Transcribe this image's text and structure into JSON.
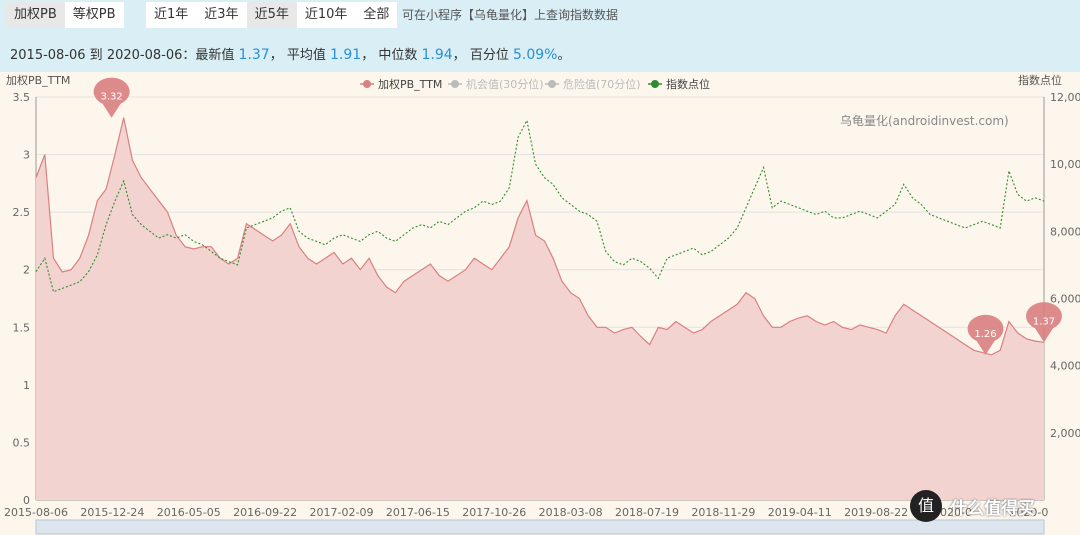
{
  "toolbar": {
    "pb_types": [
      "加权PB",
      "等权PB"
    ],
    "ranges": [
      "近1年",
      "近3年",
      "近5年",
      "近10年",
      "全部"
    ],
    "hint": "可在小程序【乌龟量化】上查询指数数据"
  },
  "stats": {
    "period": "2015-08-06 到 2020-08-06：",
    "latest_label": "最新值",
    "latest": "1.37",
    "sep1": "，",
    "avg_label": "平均值",
    "avg": "1.91",
    "sep2": "，",
    "median_label": "中位数",
    "median": "1.94",
    "sep3": "，",
    "pct_label": "百分位",
    "pct": "5.09%",
    "end": "。"
  },
  "watermark": "乌龟量化(androidinvest.com)",
  "logo": {
    "symbol": "值",
    "text": "什么值得买"
  },
  "colors": {
    "pb": "#d98080",
    "pb_fill": "#f2d3d0",
    "index": "#2e8b2e",
    "legend_dim": "#bbbbbb"
  },
  "chart_data": {
    "type": "line",
    "title": "",
    "ylabel_left": "加权PB_TTM",
    "ylabel_right": "指数点位",
    "ylim_left": [
      0,
      3.5
    ],
    "ylim_right": [
      0,
      12000
    ],
    "y_ticks_left": [
      "0",
      "0.5",
      "1",
      "1.5",
      "2",
      "2.5",
      "3",
      "3.5"
    ],
    "y_ticks_right": [
      "2,000",
      "4,000",
      "6,000",
      "8,000",
      "10,000",
      "12,000"
    ],
    "x_ticks": [
      "2015-08-06",
      "2015-12-24",
      "2016-05-05",
      "2016-09-22",
      "2017-02-09",
      "2017-06-15",
      "2017-10-26",
      "2018-03-08",
      "2018-07-19",
      "2018-11-29",
      "2019-04-11",
      "2019-08-22",
      "2020-0",
      "2020-0"
    ],
    "legend": [
      "加权PB_TTM",
      "机会值(30分位)",
      "危险值(70分位)",
      "指数点位"
    ],
    "legend_position": "top-center",
    "grid": true,
    "markers": [
      {
        "label": "3.32",
        "x_frac": 0.075,
        "value": 3.32
      },
      {
        "label": "1.26",
        "x_frac": 0.942,
        "value": 1.26
      },
      {
        "label": "1.37",
        "x_frac": 1.0,
        "value": 1.37
      }
    ],
    "series": [
      {
        "name": "加权PB_TTM",
        "values": [
          2.8,
          3.0,
          2.1,
          1.98,
          2.0,
          2.1,
          2.3,
          2.6,
          2.7,
          3.0,
          3.32,
          2.95,
          2.8,
          2.7,
          2.6,
          2.5,
          2.3,
          2.2,
          2.18,
          2.2,
          2.2,
          2.1,
          2.05,
          2.1,
          2.4,
          2.35,
          2.3,
          2.25,
          2.3,
          2.4,
          2.2,
          2.1,
          2.05,
          2.1,
          2.15,
          2.05,
          2.1,
          2.0,
          2.1,
          1.95,
          1.85,
          1.8,
          1.9,
          1.95,
          2.0,
          2.05,
          1.95,
          1.9,
          1.95,
          2.0,
          2.1,
          2.05,
          2.0,
          2.1,
          2.2,
          2.45,
          2.6,
          2.3,
          2.25,
          2.1,
          1.9,
          1.8,
          1.75,
          1.6,
          1.5,
          1.5,
          1.45,
          1.48,
          1.5,
          1.42,
          1.35,
          1.5,
          1.48,
          1.55,
          1.5,
          1.45,
          1.48,
          1.55,
          1.6,
          1.65,
          1.7,
          1.8,
          1.75,
          1.6,
          1.5,
          1.5,
          1.55,
          1.58,
          1.6,
          1.55,
          1.52,
          1.55,
          1.5,
          1.48,
          1.52,
          1.5,
          1.48,
          1.45,
          1.6,
          1.7,
          1.65,
          1.6,
          1.55,
          1.5,
          1.45,
          1.4,
          1.35,
          1.3,
          1.28,
          1.26,
          1.3,
          1.55,
          1.45,
          1.4,
          1.38,
          1.37
        ]
      },
      {
        "name": "指数点位",
        "values": [
          6800,
          7200,
          6200,
          6300,
          6400,
          6500,
          6800,
          7300,
          8200,
          8900,
          9500,
          8500,
          8200,
          8000,
          7800,
          7900,
          7800,
          7900,
          7700,
          7600,
          7400,
          7200,
          7100,
          7000,
          8100,
          8200,
          8300,
          8400,
          8600,
          8700,
          8000,
          7800,
          7700,
          7600,
          7800,
          7900,
          7800,
          7700,
          7900,
          8000,
          7800,
          7700,
          7900,
          8100,
          8200,
          8100,
          8300,
          8200,
          8400,
          8600,
          8700,
          8900,
          8800,
          8900,
          9300,
          10800,
          11300,
          10000,
          9600,
          9400,
          9000,
          8800,
          8600,
          8500,
          8300,
          7400,
          7100,
          7000,
          7200,
          7100,
          6900,
          6600,
          7200,
          7300,
          7400,
          7500,
          7300,
          7400,
          7600,
          7800,
          8100,
          8700,
          9300,
          9900,
          8700,
          8900,
          8800,
          8700,
          8600,
          8500,
          8600,
          8400,
          8400,
          8500,
          8600,
          8500,
          8400,
          8600,
          8800,
          9400,
          9000,
          8800,
          8500,
          8400,
          8300,
          8200,
          8100,
          8200,
          8300,
          8200,
          8100,
          9800,
          9100,
          8900,
          9000,
          8900
        ]
      }
    ]
  }
}
